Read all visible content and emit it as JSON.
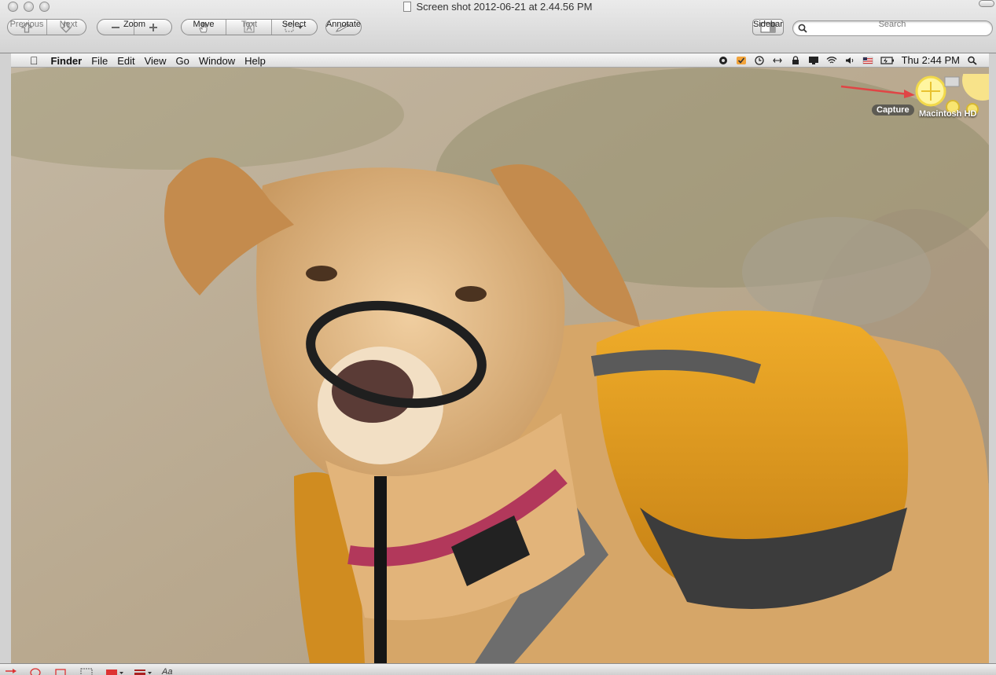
{
  "window": {
    "title": "Screen shot 2012-06-21 at 2.44.56 PM"
  },
  "toolbar": {
    "previous_label": "Previous",
    "next_label": "Next",
    "zoom_label": "Zoom",
    "move_label": "Move",
    "text_label": "Text",
    "select_label": "Select",
    "annotate_label": "Annotate",
    "sidebar_label": "Sidebar",
    "search_label": "Search",
    "search_value": ""
  },
  "menubar": {
    "items": [
      "Finder",
      "File",
      "Edit",
      "View",
      "Go",
      "Window",
      "Help"
    ],
    "clock": "Thu 2:44 PM"
  },
  "desktop": {
    "capture_label": "Capture",
    "disk_label": "Macintosh HD"
  },
  "bottom_bar": {
    "text_tool": "Aa"
  },
  "colors": {
    "arrow": "#e04545",
    "menubar": "#e8e8e8",
    "backpack": "#e8a020"
  }
}
